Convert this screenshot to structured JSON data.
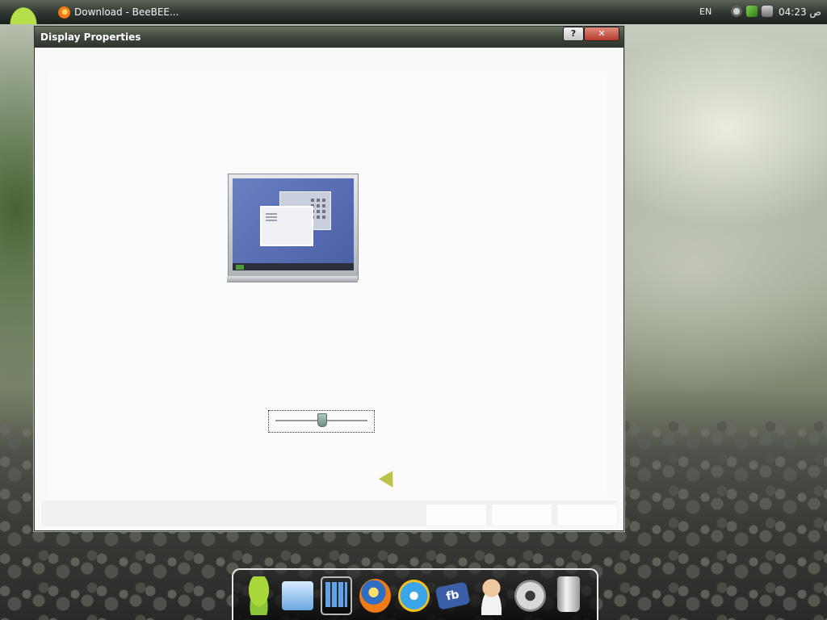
{
  "taskbar": {
    "task_label": "Download - BeeBEE...",
    "language": "EN",
    "clock": "ص 04:23"
  },
  "window": {
    "title": "Display Properties",
    "help_label": "?",
    "close_label": "✕"
  },
  "slider": {
    "value_fraction": 0.5
  },
  "dock": {
    "items": [
      {
        "name": "android-icon"
      },
      {
        "name": "network-icon"
      },
      {
        "name": "tablet-icon"
      },
      {
        "name": "firefox-icon"
      },
      {
        "name": "internet-explorer-icon"
      },
      {
        "name": "facebook-icon",
        "label": "fb"
      },
      {
        "name": "support-agent-icon"
      },
      {
        "name": "settings-gear-icon"
      },
      {
        "name": "trash-icon"
      }
    ]
  },
  "colors": {
    "title_bar": "#434a40",
    "close_button": "#b5392a",
    "monitor_screen": "#5b6fb5"
  }
}
